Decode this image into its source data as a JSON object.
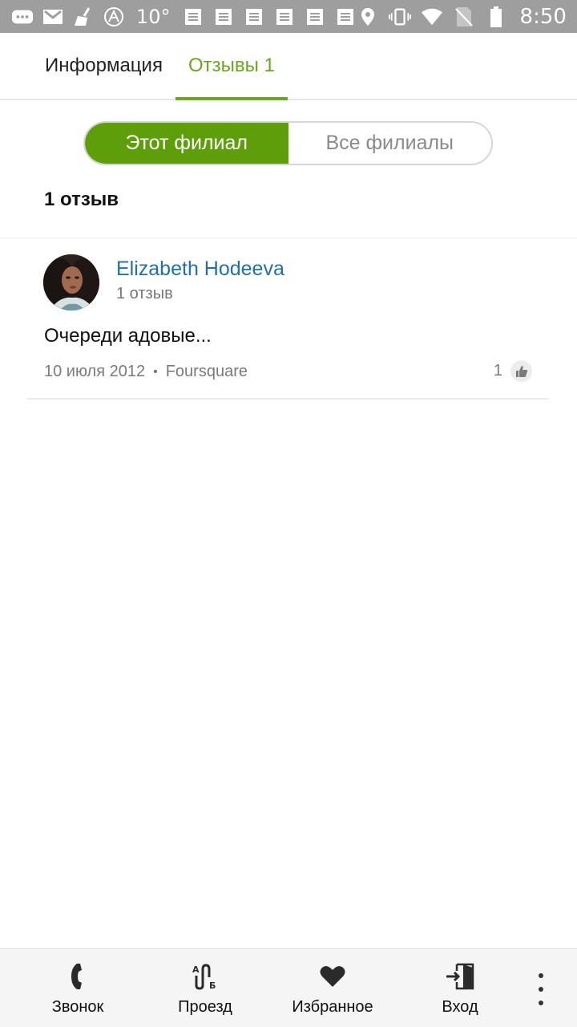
{
  "status_bar": {
    "temperature": "10°",
    "time": "8:50"
  },
  "tabs": [
    {
      "label": "Информация"
    },
    {
      "label": "Отзывы 1"
    }
  ],
  "segment": {
    "left": "Этот филиал",
    "right": "Все филиалы"
  },
  "review_count": "1 отзыв",
  "review": {
    "author": "Elizabeth Hodeeva",
    "author_reviews": "1 отзыв",
    "text": "Очереди адовые...",
    "date": "10 июля 2012",
    "separator": "•",
    "source": "Foursquare",
    "likes": "1"
  },
  "bottom_nav": [
    {
      "label": "Звонок",
      "icon": "phone-icon"
    },
    {
      "label": "Проезд",
      "icon": "route-icon"
    },
    {
      "label": "Избранное",
      "icon": "heart-icon"
    },
    {
      "label": "Вход",
      "icon": "login-icon"
    }
  ],
  "colors": {
    "accent_green": "#6aa61e",
    "segment_green": "#5e9e0b",
    "author_blue": "#1d72a6",
    "status_bar": "#9e9e9e"
  }
}
